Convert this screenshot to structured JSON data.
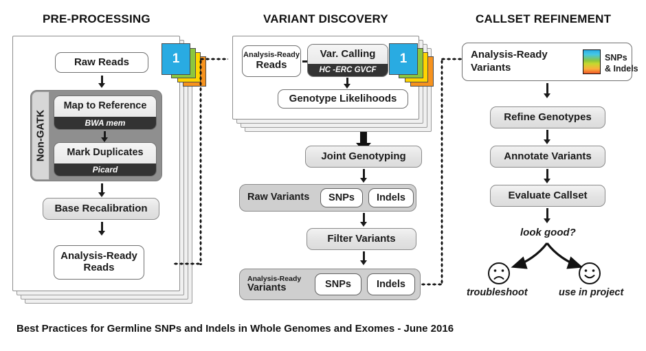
{
  "caption": "Best Practices for Germline SNPs and Indels in Whole Genomes and Exomes - June 2016",
  "columns": [
    {
      "title": "PRE-PROCESSING"
    },
    {
      "title": "VARIANT DISCOVERY"
    },
    {
      "title": "CALLSET REFINEMENT"
    }
  ],
  "preprocessing": {
    "raw_reads": "Raw Reads",
    "nongatk_label": "Non-GATK",
    "map_to_reference": {
      "name": "Map to Reference",
      "tool": "BWA mem"
    },
    "mark_duplicates": {
      "name": "Mark Duplicates",
      "tool": "Picard"
    },
    "base_recalibration": "Base Recalibration",
    "analysis_ready_reads": "Analysis-Ready\nReads",
    "analysis_ready_reads_line1": "Analysis-Ready",
    "analysis_ready_reads_line2": "Reads",
    "sample_tab_number": "1"
  },
  "variant_discovery": {
    "input_line1": "Analysis-Ready",
    "input_line2": "Reads",
    "var_calling": {
      "name": "Var. Calling",
      "tool": "HC -ERC GVCF"
    },
    "genotype_likelihoods": "Genotype Likelihoods",
    "joint_genotyping": "Joint Genotyping",
    "raw_variants": {
      "label": "Raw Variants",
      "snps": "SNPs",
      "indels": "Indels"
    },
    "filter_variants": "Filter Variants",
    "analysis_ready_variants": {
      "label_line1": "Analysis-Ready",
      "label_line2": "Variants",
      "snps": "SNPs",
      "indels": "Indels"
    },
    "sample_tab_number": "1"
  },
  "callset_refinement": {
    "input_line1": "Analysis-Ready",
    "input_line2": "Variants",
    "legend_line1": "SNPs",
    "legend_line2": "& Indels",
    "refine_genotypes": "Refine Genotypes",
    "annotate_variants": "Annotate Variants",
    "evaluate_callset": "Evaluate Callset",
    "decision": "look good?",
    "branch_no": "troubleshoot",
    "branch_yes": "use in project"
  },
  "colors": {
    "tab_cyan": "#29ABE2",
    "tab_green": "#8CC63F",
    "tab_yellow": "#FFD500",
    "tab_orange": "#F7931E",
    "gradient_top": "#29ABE2",
    "gradient_mid": "#8CC63F",
    "gradient_low": "#FBB03B",
    "gradient_bottom": "#F1592A",
    "dark_bar": "#333333",
    "band_gray": "#CFCFCF",
    "nongatk_gray": "#8F8F8F"
  }
}
